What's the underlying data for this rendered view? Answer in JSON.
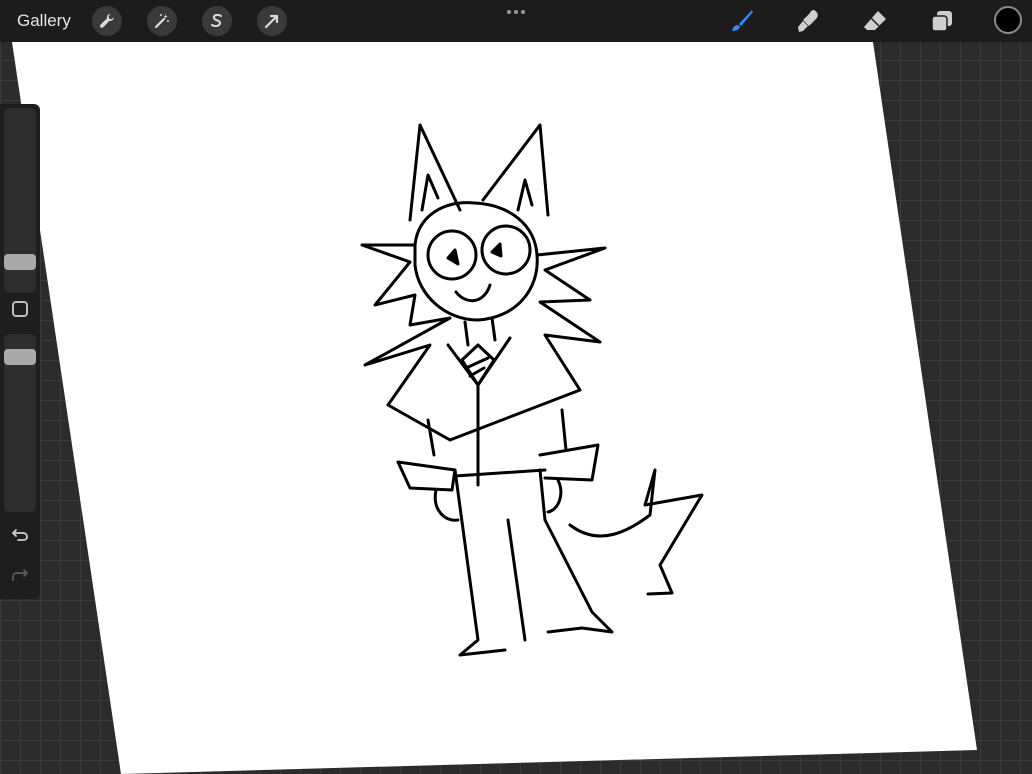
{
  "topbar": {
    "gallery_label": "Gallery",
    "left_tools": [
      "wrench-icon",
      "magic-wand-icon",
      "selection-s-icon",
      "transform-arrow-icon"
    ],
    "more_icon": "ellipsis-icon",
    "right_tools": [
      "brush-icon",
      "smudge-icon",
      "eraser-icon",
      "layers-icon"
    ],
    "active_tool": "brush-icon",
    "current_color": "#000000",
    "accent_color": "#2f8cff"
  },
  "sidebar": {
    "brush_size_label": "",
    "opacity_label": "",
    "icons": [
      "modify-square-icon",
      "undo-icon",
      "redo-icon"
    ]
  },
  "canvas": {
    "background": "#ffffff",
    "stroke_color": "#000000"
  }
}
